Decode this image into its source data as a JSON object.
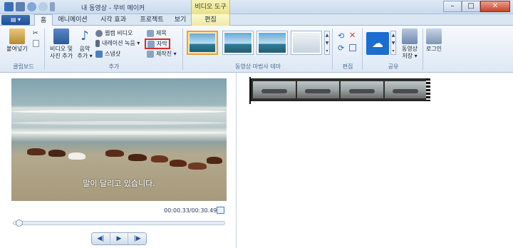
{
  "window": {
    "title": "내 동영상 - 무비 메이커",
    "context_tab_header": "비디오 도구",
    "controls": {
      "minimize": "–",
      "maximize": "□",
      "close": "✕"
    }
  },
  "file_menu": {
    "label": "▤ ▾"
  },
  "tabs": [
    {
      "label": "홈",
      "active": true
    },
    {
      "label": "애니메이션"
    },
    {
      "label": "시각 효과"
    },
    {
      "label": "프로젝트"
    },
    {
      "label": "보기"
    },
    {
      "label": "편집",
      "context": true
    }
  ],
  "ribbon": {
    "clipboard": {
      "paste": "붙여넣기",
      "group": "클립보드"
    },
    "add": {
      "add_videos_photos": "비디오 및\n사진 추가",
      "add_music": "음악\n추가 ▾",
      "webcam_video": "웹캠 비디오",
      "record_narration": "내레이션 녹음 ▾",
      "snapshot": "스냅샷",
      "title": "제목",
      "caption": "자막",
      "credits": "제작진 ▾",
      "group": "추가"
    },
    "themes": {
      "group": "동영상 마법사 테마",
      "count": 4
    },
    "editing": {
      "group": "편집"
    },
    "share": {
      "save_movie": "동영상\n저장 ▾",
      "group": "공유"
    },
    "signin": {
      "label": "로그인"
    }
  },
  "preview": {
    "caption_text": "말이 달리고 있습니다.",
    "timecode": "00:00.33/00:30.49",
    "progress": 0.011
  },
  "transport": {
    "prev_frame": "◀|",
    "play": "▶",
    "next_frame": "|▶"
  },
  "colors": {
    "highlight_box": "#e02828",
    "selected_theme": "#e8a23a",
    "accent": "#1f4f98"
  }
}
